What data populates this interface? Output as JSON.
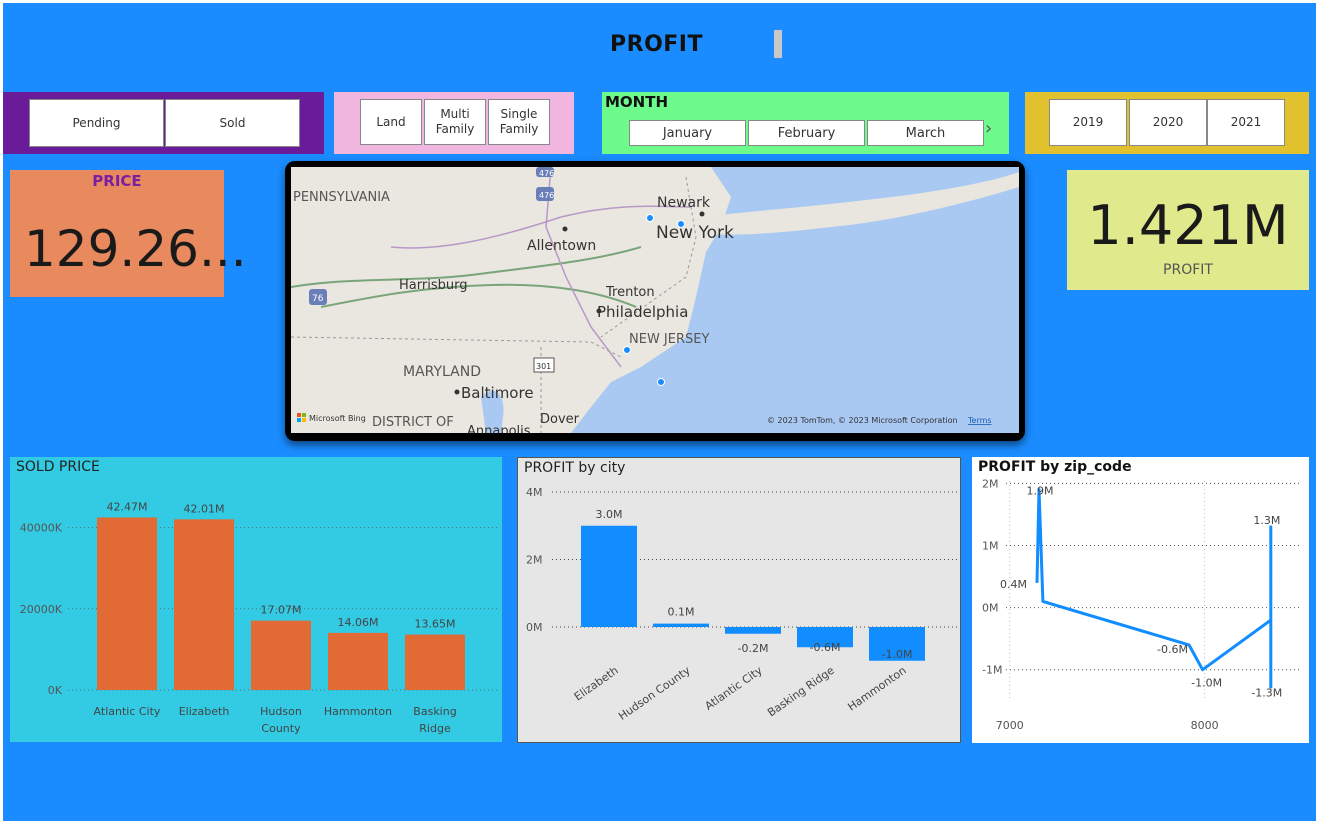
{
  "page_title": "PROFIT",
  "status_slicer": [
    "Pending",
    "Sold"
  ],
  "type_slicer": [
    "Land",
    "Multi Family",
    "Single Family"
  ],
  "month_slicer": {
    "title": "MONTH",
    "items": [
      "January",
      "February",
      "March"
    ]
  },
  "year_slicer": [
    "2019",
    "2020",
    "2021"
  ],
  "price_card": {
    "label": "PRICE",
    "value": "129.26..."
  },
  "profit_card": {
    "value": "1.421M",
    "label": "PROFIT"
  },
  "map": {
    "labels": [
      "PENNSYLVANIA",
      "Newark",
      "New York",
      "Allentown",
      "Harrisburg",
      "Trenton",
      "Philadelphia",
      "NEW JERSEY",
      "MARYLAND",
      "Baltimore",
      "DISTRICT OF",
      "Annapolis",
      "Dover"
    ],
    "shields": [
      "476",
      "476",
      "76",
      "301"
    ],
    "branding": "Microsoft Bing",
    "copyright": "© 2023 TomTom, © 2023 Microsoft Corporation",
    "terms": "Terms"
  },
  "colors": {
    "background": "#1a8cff",
    "bar_orange": "#e26a35",
    "bar_blue": "#118dff",
    "status_purple": "#6a1b9a",
    "type_pink": "#f0b6e0",
    "month_green": "#6dfc8c",
    "year_gold": "#e2c12e"
  },
  "chart_data": [
    {
      "type": "bar",
      "title": "SOLD PRICE",
      "categories": [
        "Atlantic City",
        "Elizabeth",
        "Hudson County",
        "Hammonton",
        "Basking Ridge"
      ],
      "values": [
        42.47,
        42.01,
        17.07,
        14.06,
        13.65
      ],
      "data_labels": [
        "42.47M",
        "42.01M",
        "17.07M",
        "14.06M",
        "13.65M"
      ],
      "ytick_labels": [
        "0K",
        "20000K",
        "40000K"
      ],
      "ylim": [
        0,
        48
      ]
    },
    {
      "type": "bar",
      "title": "PROFIT by city",
      "categories": [
        "Elizabeth",
        "Hudson County",
        "Atlantic City",
        "Basking Ridge",
        "Hammonton"
      ],
      "values": [
        3.0,
        0.1,
        -0.2,
        -0.6,
        -1.0
      ],
      "data_labels": [
        "3.0M",
        "0.1M",
        "-0.2M",
        "-0.6M",
        "-1.0M"
      ],
      "ytick_labels": [
        "0M",
        "2M",
        "4M"
      ],
      "ylim": [
        -1.0,
        4.0
      ]
    },
    {
      "type": "line",
      "title": "PROFIT by zip_code",
      "x": [
        7140,
        7150,
        7170,
        7920,
        7990,
        8340,
        8340,
        8340
      ],
      "y": [
        0.4,
        1.9,
        0.1,
        -0.6,
        -1.0,
        -0.2,
        1.3,
        -1.3
      ],
      "data_labels": [
        "0.4M",
        "1.9M",
        "-0.6M",
        "-1.0M",
        "1.3M",
        "-1.3M"
      ],
      "ytick_labels": [
        "-1M",
        "0M",
        "1M",
        "2M"
      ],
      "xtick_labels": [
        "7000",
        "8000"
      ],
      "xlim": [
        6950,
        8500
      ],
      "ylim": [
        -1.6,
        2.2
      ]
    }
  ]
}
